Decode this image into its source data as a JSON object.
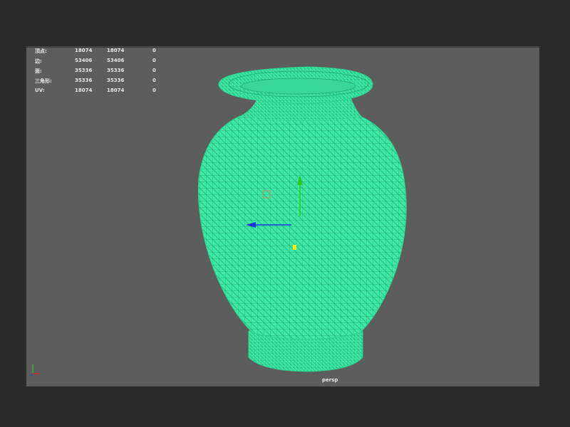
{
  "hud": {
    "rows": [
      {
        "label": "顶点:",
        "v1": "18074",
        "v2": "18074",
        "v3": "0"
      },
      {
        "label": "边:",
        "v1": "53406",
        "v2": "53406",
        "v3": "0"
      },
      {
        "label": "面:",
        "v1": "35336",
        "v2": "35336",
        "v3": "0"
      },
      {
        "label": "三角形:",
        "v1": "35336",
        "v2": "35336",
        "v3": "0"
      },
      {
        "label": "UV:",
        "v1": "18074",
        "v2": "18074",
        "v3": "0"
      }
    ]
  },
  "viewport": {
    "camera": "persp"
  },
  "colors": {
    "background": "#2b2b2b",
    "viewport": "#5d5d5d",
    "mesh_fill": "#3ee8a6",
    "mesh_wire": "#1fb378",
    "manip_y": "#22cc22",
    "manip_x": "#2233dd",
    "manip_center": "#ffee00"
  },
  "icons": {
    "axis_indicator": "axis-triad-icon",
    "pivot": "pivot-square-icon"
  }
}
